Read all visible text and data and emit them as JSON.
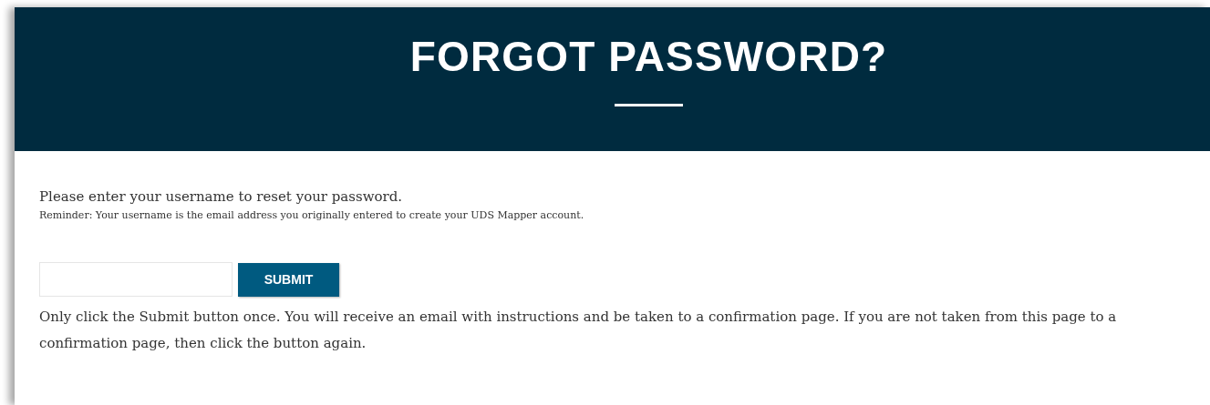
{
  "header": {
    "title": "FORGOT PASSWORD?"
  },
  "intro": "Please enter your username to reset your password.",
  "reminder": "Reminder: Your username is the email address you originally entered to create your UDS Mapper account.",
  "form": {
    "submit_button": "SUBMIT"
  },
  "note": "Only click the Submit button once. You will receive an email with instructions and be taken to a confirmation page. If you are not taken from this page to a confirmation page, then click the button again."
}
